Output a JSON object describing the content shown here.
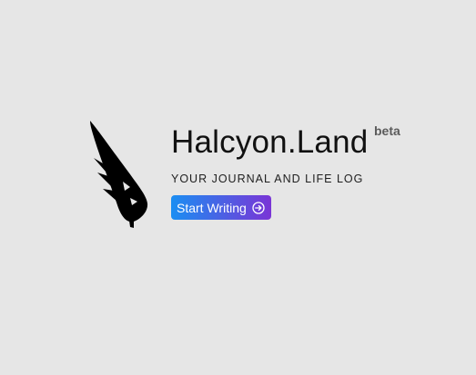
{
  "brand": {
    "name": "Halcyon.Land",
    "badge": "beta",
    "tagline": "YOUR JOURNAL AND LIFE LOG"
  },
  "cta": {
    "label": "Start Writing",
    "icon": "arrow-right-circle-icon"
  },
  "logo": {
    "icon": "quill-feather-icon"
  },
  "colors": {
    "background": "#e6e6e6",
    "gradient_start": "#1b8ef2",
    "gradient_end": "#7a35d6",
    "badge": "#5b5b5b"
  }
}
